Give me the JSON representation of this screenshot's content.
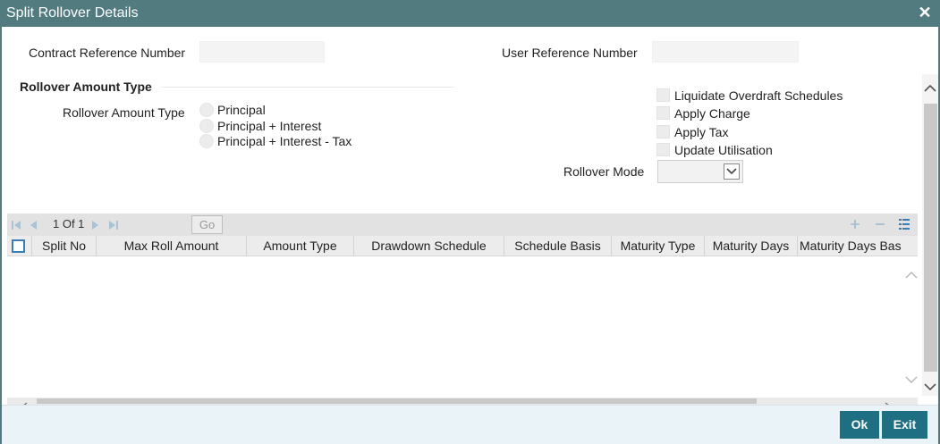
{
  "window": {
    "title": "Split Rollover Details",
    "close_glyph": "✕"
  },
  "header": {
    "contract_ref_label": "Contract Reference Number",
    "contract_ref_value": "",
    "user_ref_label": "User Reference Number",
    "user_ref_value": ""
  },
  "rollover_amount_type": {
    "section_title": "Rollover Amount Type",
    "field_label": "Rollover Amount Type",
    "options": [
      "Principal",
      "Principal + Interest",
      "Principal + Interest - Tax"
    ]
  },
  "checkboxes": [
    "Liquidate Overdraft Schedules",
    "Apply Charge",
    "Apply Tax",
    "Update Utilisation"
  ],
  "rollover_mode": {
    "label": "Rollover Mode",
    "value": ""
  },
  "grid": {
    "pager": "1 Of 1",
    "go_label": "Go",
    "columns": [
      "Split No",
      "Max Roll Amount",
      "Amount Type",
      "Drawdown Schedule",
      "Schedule Basis",
      "Maturity Type",
      "Maturity Days",
      "Maturity Days Bas"
    ],
    "icons": [
      "first-page-icon",
      "prev-page-icon",
      "next-page-icon",
      "last-page-icon",
      "add-row-icon",
      "delete-row-icon",
      "single-view-icon"
    ]
  },
  "footer": {
    "ok_label": "Ok",
    "exit_label": "Exit"
  },
  "colors": {
    "titlebar": "#527b80",
    "button": "#1f6f82",
    "footer": "#eaf3f8"
  }
}
